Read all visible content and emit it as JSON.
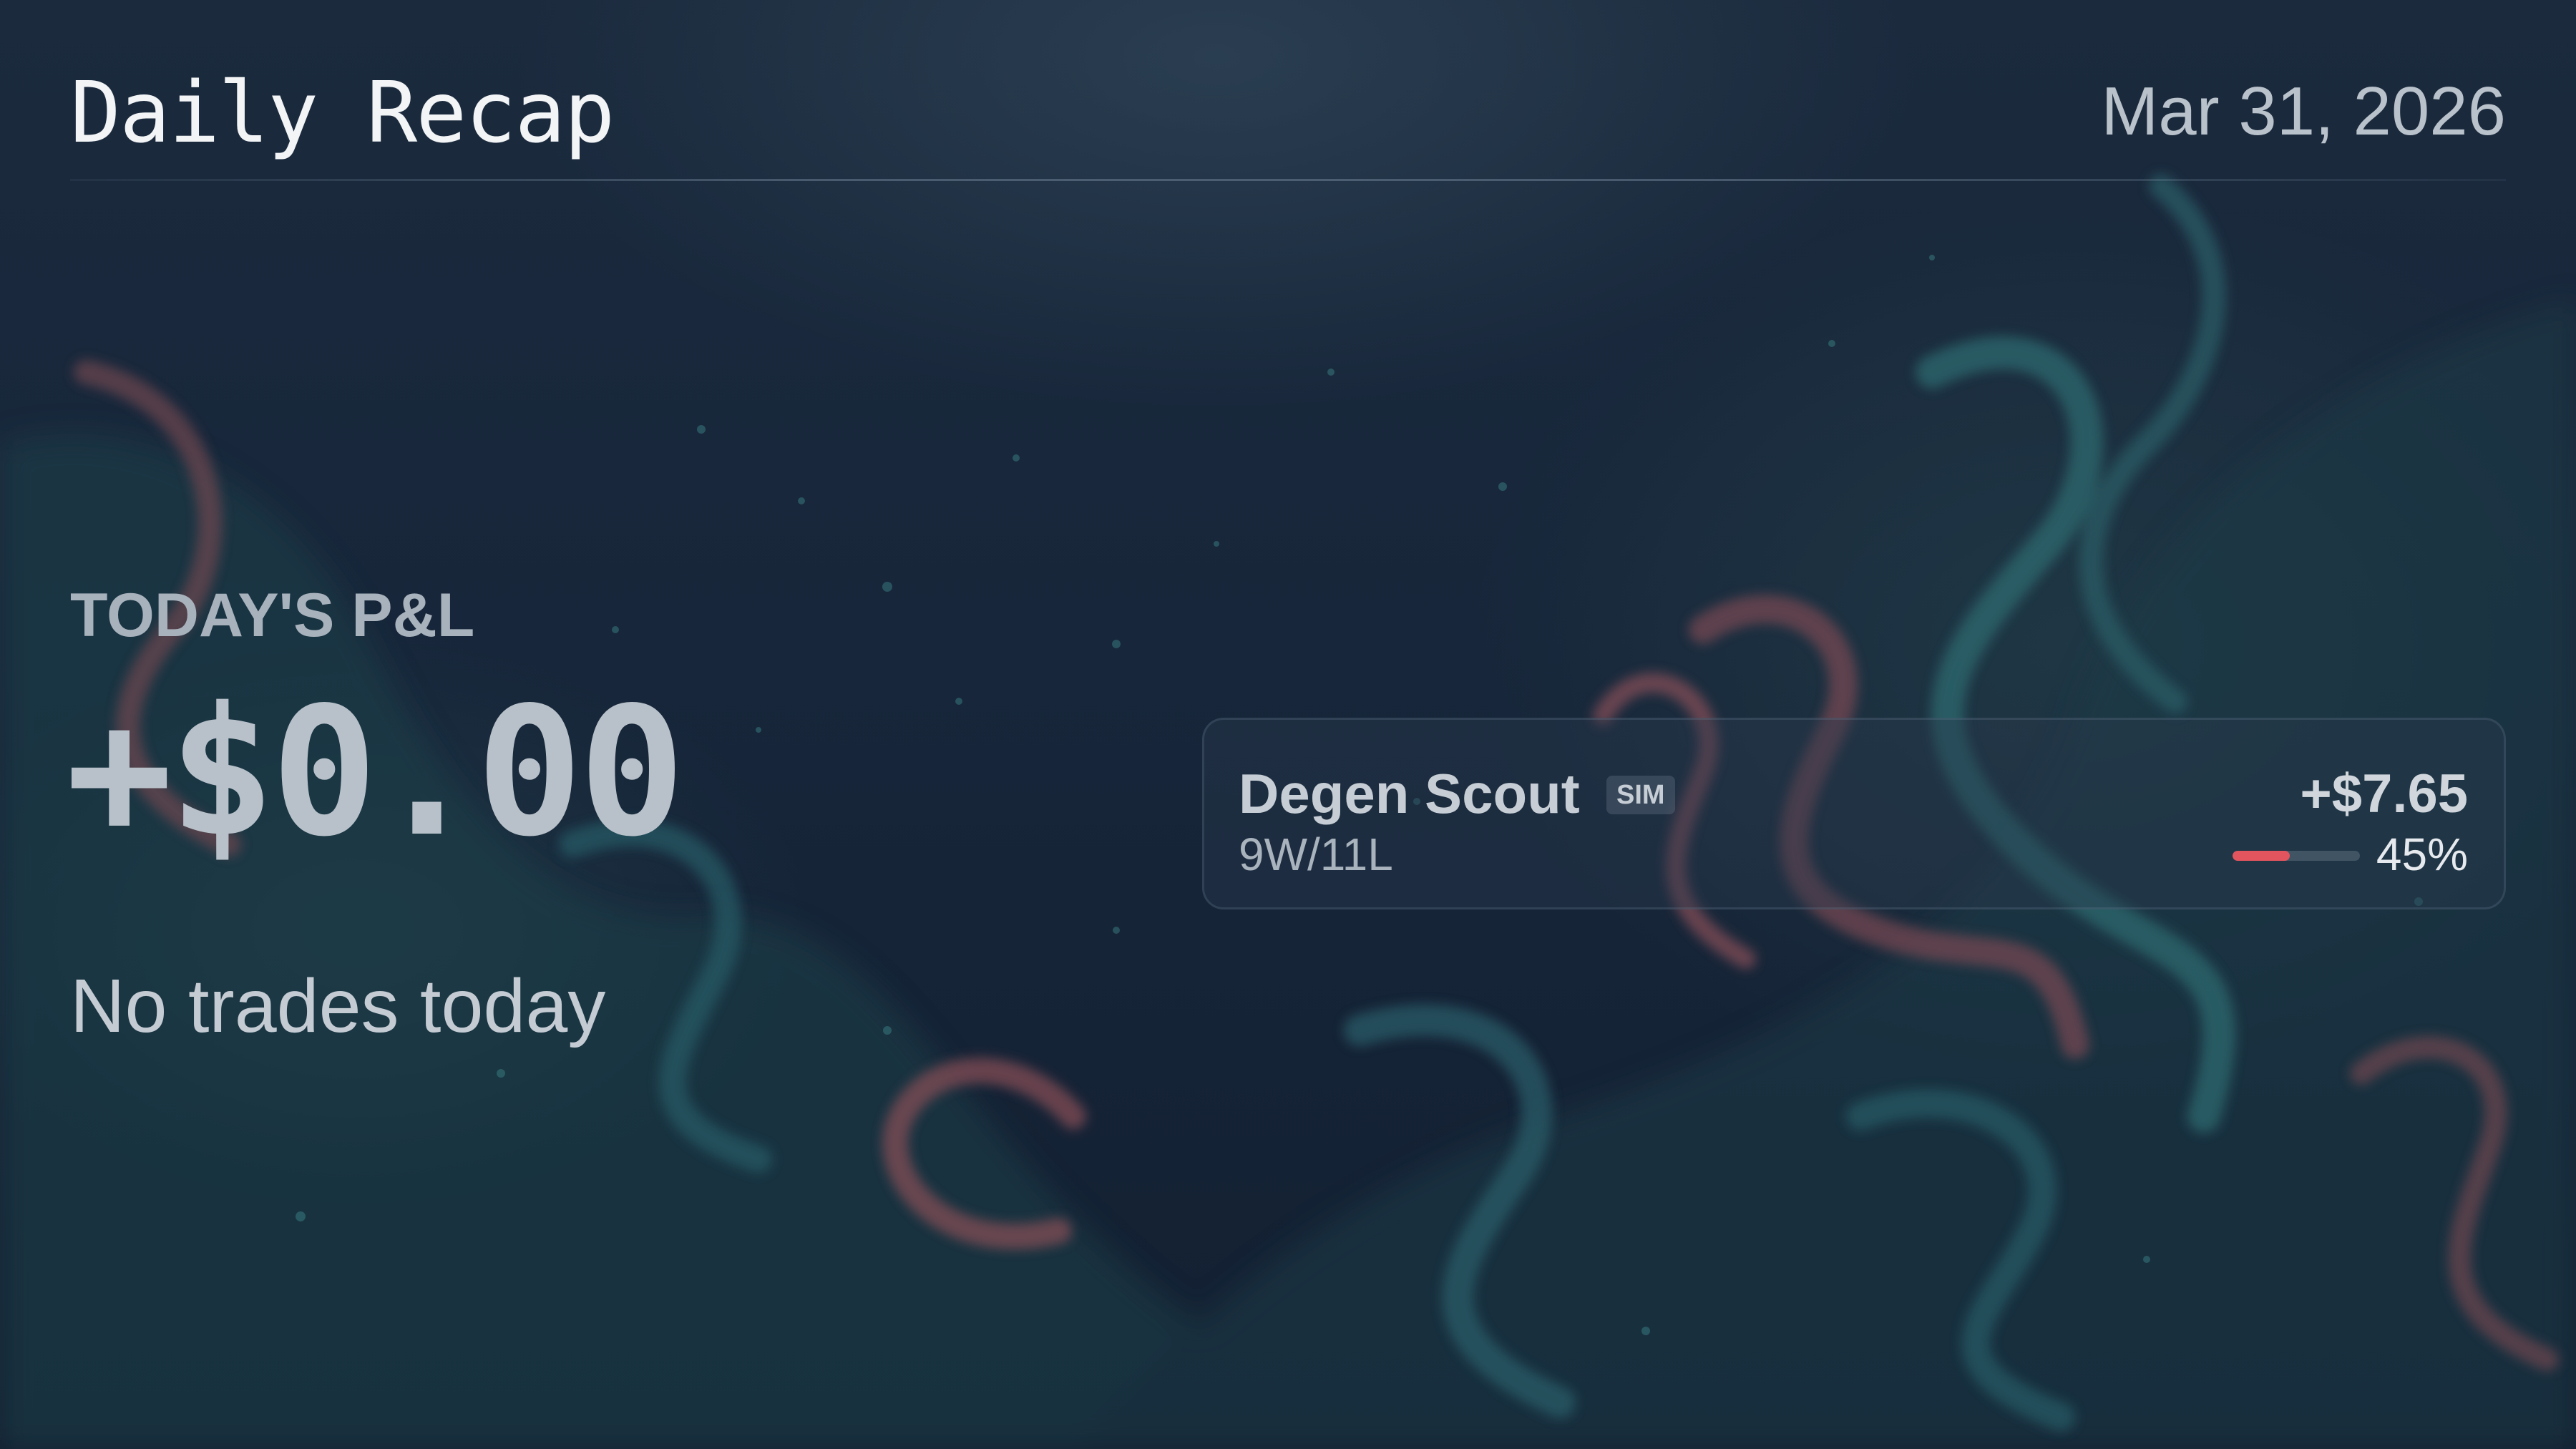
{
  "header": {
    "title": "Daily Recap",
    "date": "Mar 31, 2026"
  },
  "summary": {
    "pnl_label": "TODAY'S P&L",
    "pnl_value": "+$0.00",
    "empty_message": "No trades today"
  },
  "agents": [
    {
      "name": "Degen Scout",
      "badge": "SIM",
      "record": "9W/11L",
      "pnl": "+$7.65",
      "win_rate_text": "45%",
      "win_rate": 0.45
    }
  ],
  "colors": {
    "background": "#17263a",
    "accent_negative": "#e2555e",
    "text_primary": "#f2f4f6",
    "text_muted": "#a8b2bc"
  }
}
